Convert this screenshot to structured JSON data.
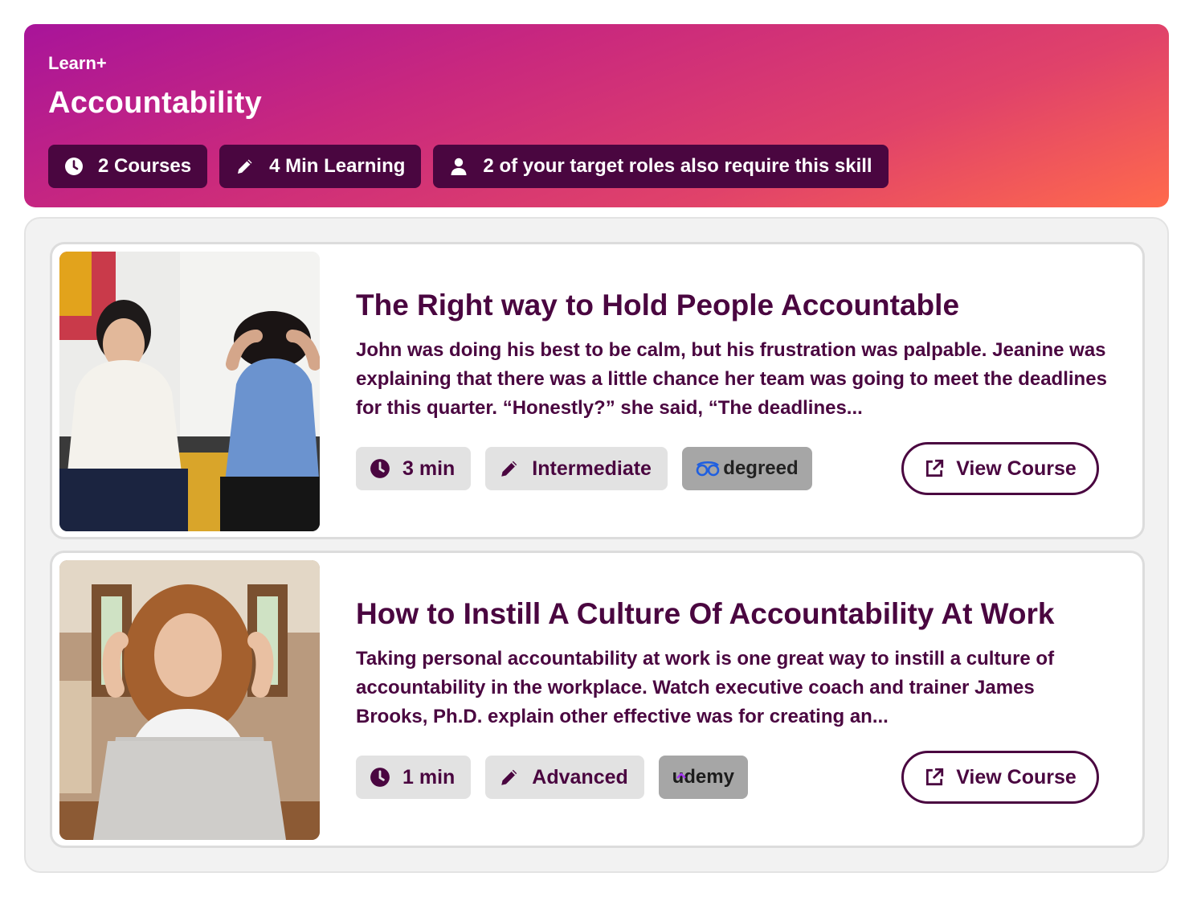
{
  "header": {
    "eyebrow": "Learn+",
    "title": "Accountability",
    "pills": [
      {
        "icon": "clock-icon",
        "label": "2 Courses"
      },
      {
        "icon": "pencil-icon",
        "label": "4 Min Learning"
      },
      {
        "icon": "user-icon",
        "label": "2 of your target roles also require this skill"
      }
    ]
  },
  "courses": [
    {
      "title": "The Right way to Hold People Accountable",
      "description": "John was doing his best to be calm, but his frustration was palpable. Jeanine was explaining that there was a little chance her team was going to meet the deadlines for this quarter. “Honestly?” she said, “The deadlines...",
      "duration": "3 min",
      "level": "Intermediate",
      "provider": "degreed",
      "cta": "View Course"
    },
    {
      "title": "How to Instill A Culture Of Accountability At Work",
      "description": "Taking personal accountability at work is one great way to instill a culture of accountability in the workplace. Watch executive coach and trainer James Brooks, Ph.D. explain other effective was for creating an...",
      "duration": "1 min",
      "level": "Advanced",
      "provider": "udemy",
      "cta": "View Course"
    }
  ],
  "colors": {
    "brand_dark": "#4a0640",
    "gradient_start": "#a8149a",
    "gradient_end": "#ff6a4c",
    "tag_bg": "#e2e2e2",
    "provider_bg": "#a6a6a6",
    "degreed_blue": "#1f5fe0",
    "udemy_purple": "#a435f0"
  }
}
